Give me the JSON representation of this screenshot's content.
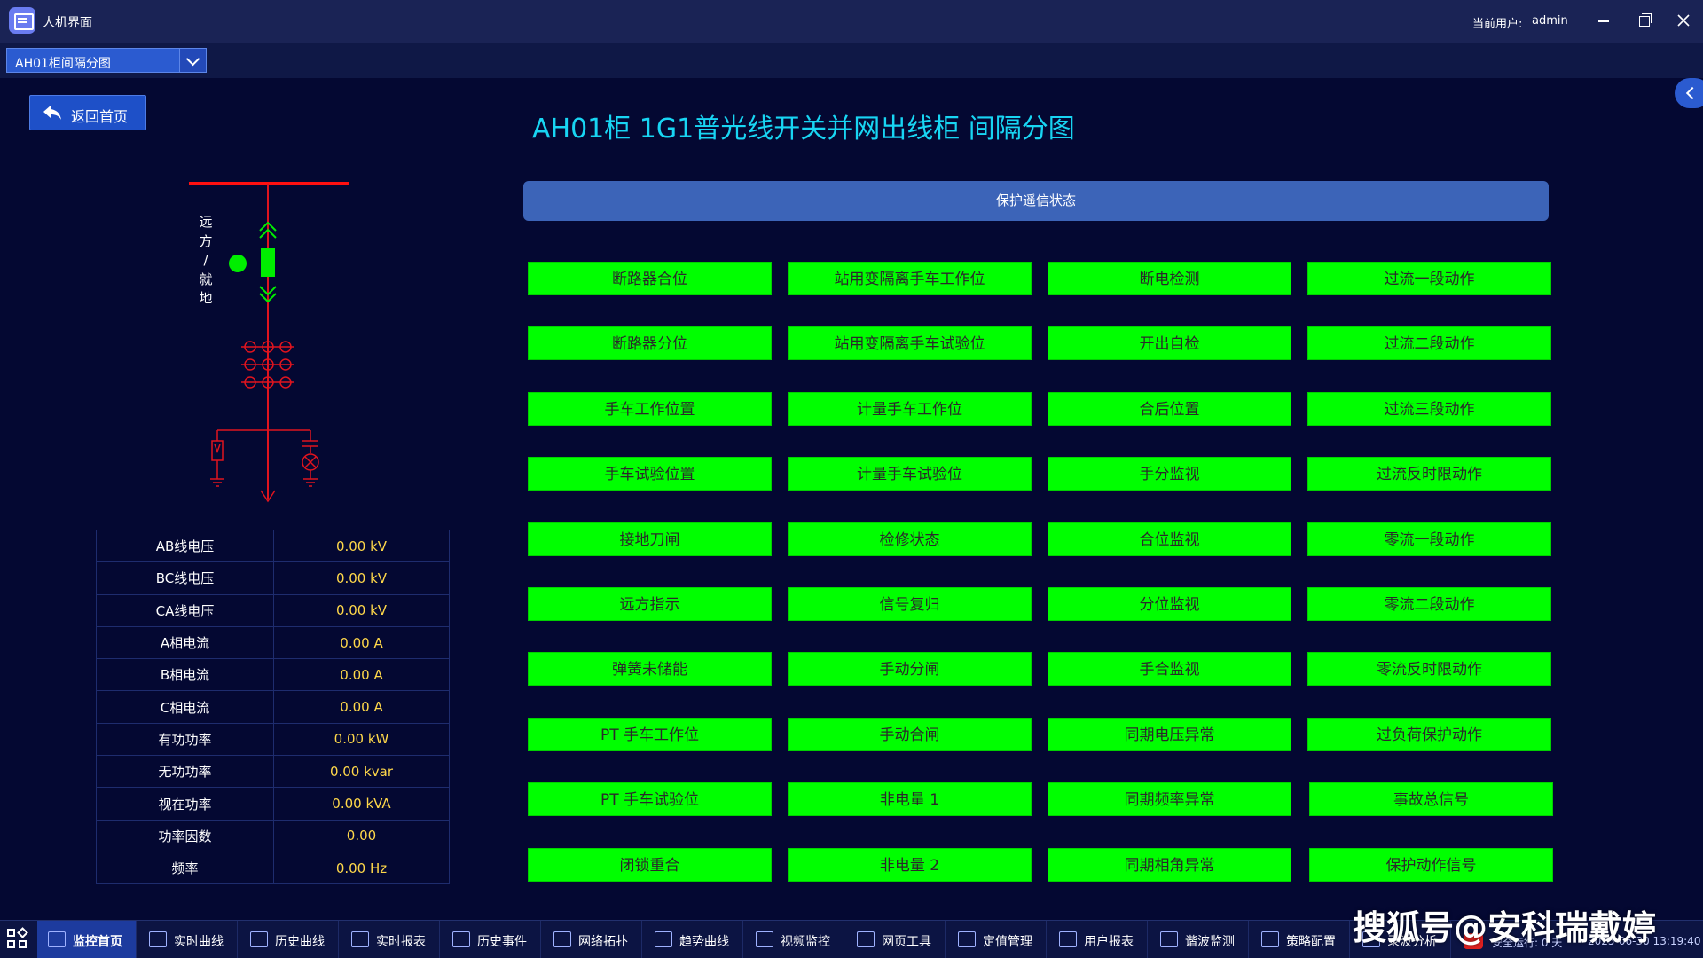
{
  "window": {
    "title": "人机界面",
    "user_label": "当前用户:",
    "user_name": "admin"
  },
  "toolbar": {
    "selected_view": "AH01柜间隔分图"
  },
  "back_button": {
    "label": "返回首页"
  },
  "page_title": "AH01柜 1G1普光线开关并网出线柜  间隔分图",
  "diagram": {
    "remote_local_label": [
      "远",
      "方",
      "/",
      "就",
      "地"
    ],
    "colors": {
      "bus": "#ff1010",
      "line": "#e0141e",
      "breaker": "#00ee00",
      "arrow": "#00ee00"
    }
  },
  "measurements": [
    {
      "label": "AB线电压",
      "value": "0.00 kV"
    },
    {
      "label": "BC线电压",
      "value": "0.00 kV"
    },
    {
      "label": "CA线电压",
      "value": "0.00 kV"
    },
    {
      "label": "A相电流",
      "value": "0.00 A"
    },
    {
      "label": "B相电流",
      "value": "0.00 A"
    },
    {
      "label": "C相电流",
      "value": "0.00 A"
    },
    {
      "label": "有功功率",
      "value": "0.00 kW"
    },
    {
      "label": "无功功率",
      "value": "0.00 kvar"
    },
    {
      "label": "视在功率",
      "value": "0.00 kVA"
    },
    {
      "label": "功率因数",
      "value": "0.00"
    },
    {
      "label": "频率",
      "value": "0.00 Hz"
    }
  ],
  "protection": {
    "header": "保护遥信状态",
    "status_color": "#00ff00",
    "columns": [
      [
        "断路器合位",
        "断路器分位",
        "手车工作位置",
        "手车试验位置",
        "接地刀闸",
        "远方指示",
        "弹簧未储能",
        "PT 手车工作位",
        "PT 手车试验位",
        "闭锁重合"
      ],
      [
        "站用变隔离手车工作位",
        "站用变隔离手车试验位",
        "计量手车工作位",
        "计量手车试验位",
        "检修状态",
        "信号复归",
        "手动分闸",
        "手动合闸",
        "非电量 1",
        "非电量 2"
      ],
      [
        "断电检测",
        "开出自检",
        "合后位置",
        "手分监视",
        "合位监视",
        "分位监视",
        "手合监视",
        "同期电压异常",
        "同期频率异常",
        "同期相角异常"
      ],
      [
        "过流一段动作",
        "过流二段动作",
        "过流三段动作",
        "过流反时限动作",
        "零流一段动作",
        "零流二段动作",
        "零流反时限动作",
        "过负荷保护动作",
        "事故总信号",
        "保护动作信号"
      ]
    ]
  },
  "taskbar": {
    "items": [
      {
        "label": "监控首页",
        "icon": "home-icon",
        "active": true
      },
      {
        "label": "实时曲线",
        "icon": "line-chart-icon"
      },
      {
        "label": "历史曲线",
        "icon": "history-chart-icon"
      },
      {
        "label": "实时报表",
        "icon": "report-icon"
      },
      {
        "label": "历史事件",
        "icon": "edit-icon"
      },
      {
        "label": "网络拓扑",
        "icon": "network-icon"
      },
      {
        "label": "趋势曲线",
        "icon": "trend-icon"
      },
      {
        "label": "视频监控",
        "icon": "video-icon"
      },
      {
        "label": "网页工具",
        "icon": "web-icon"
      },
      {
        "label": "定值管理",
        "icon": "settings-icon"
      },
      {
        "label": "用户报表",
        "icon": "user-report-icon"
      },
      {
        "label": "谐波监测",
        "icon": "wave-icon"
      },
      {
        "label": "策略配置",
        "icon": "config-icon"
      },
      {
        "label": "录波分析",
        "icon": "recording-icon"
      }
    ],
    "runtime": "安全运行: 0 天",
    "clock": "2025-06-30 13:19:40"
  },
  "watermark": "搜狐号@安科瑞戴婷"
}
